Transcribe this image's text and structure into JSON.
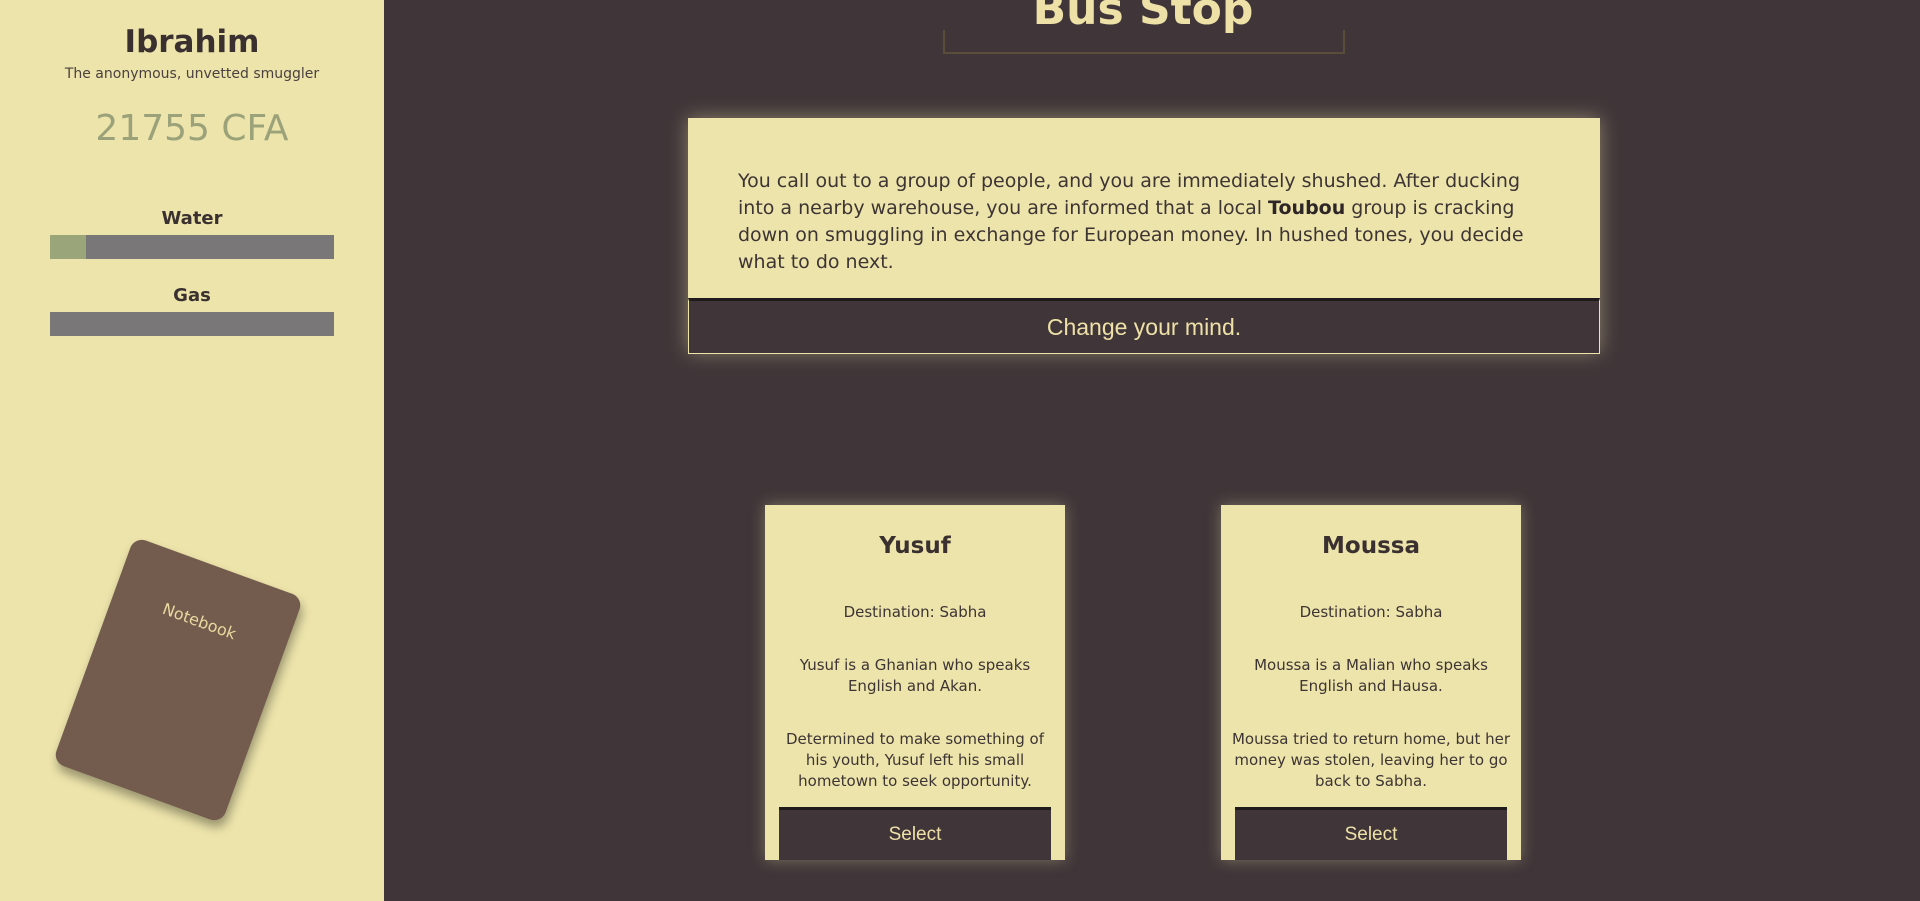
{
  "sidebar": {
    "name": "Ibrahim",
    "subtitle": "The anonymous, unvetted smuggler",
    "money": "21755 CFA",
    "meters": [
      {
        "label": "Water",
        "fraction": 0.125
      },
      {
        "label": "Gas",
        "fraction": 0
      }
    ],
    "notebook_label": "Notebook"
  },
  "location": {
    "title": "Bus Stop"
  },
  "story": {
    "text_before": "You call out to a group of people, and you are immediately shushed. After ducking into a nearby warehouse, you are informed that a local ",
    "text_bold": "Toubou",
    "text_after": " group is cracking down on smuggling in exchange for European money. In hushed tones, you decide what to do next.",
    "button_label": "Change your mind."
  },
  "cards": [
    {
      "name": "Yusuf",
      "destination": "Destination: Sabha",
      "description": "Yusuf is a Ghanian who speaks English and Akan.",
      "story": "Determined to make something of his youth, Yusuf left his small hometown to seek opportunity.",
      "button_label": "Select"
    },
    {
      "name": "Moussa",
      "destination": "Destination: Sabha",
      "description": "Moussa is a Malian who speaks English and Hausa.",
      "story": "Moussa tried to return home, but her money was stolen, leaving her to go back to Sabha.",
      "button_label": "Select"
    }
  ],
  "colors": {
    "background": "#403639",
    "panel": "#ede4ab",
    "accent_text": "#eee1a8",
    "money": "#9ba27a",
    "meter_fill": "#9aa57a",
    "meter_empty": "#797777",
    "notebook": "#735b4d"
  }
}
